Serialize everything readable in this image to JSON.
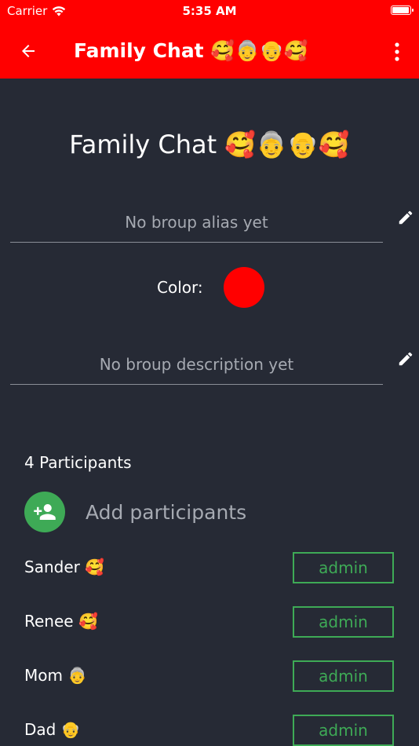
{
  "status_bar": {
    "carrier": "Carrier",
    "time": "5:35 AM",
    "battery_level": 0.95
  },
  "header": {
    "title": "Family Chat 🥰👵👴🥰",
    "back_icon": "arrow-left-icon",
    "menu_icon": "more-vert-icon"
  },
  "group": {
    "name": "Family Chat 🥰👵👴🥰",
    "alias_placeholder": "No broup alias yet",
    "color_label": "Color:",
    "color": "#ff0000",
    "description_placeholder": "No broup description yet"
  },
  "participants": {
    "count_label": "4 Participants",
    "add_label": "Add participants",
    "items": [
      {
        "name": "Sander 🥰",
        "role": "admin"
      },
      {
        "name": "Renee 🥰",
        "role": "admin"
      },
      {
        "name": "Mom 👵",
        "role": "admin"
      },
      {
        "name": "Dad 👴",
        "role": "admin"
      }
    ]
  },
  "colors": {
    "accent": "#ff0000",
    "background": "#262a35",
    "admin_green": "#3eaa56"
  }
}
